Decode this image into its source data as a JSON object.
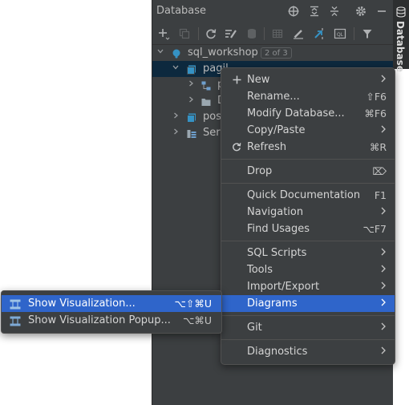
{
  "toolwindow": {
    "title": "Database",
    "header_icons": [
      "crosshair-icon",
      "expand-all-icon",
      "collapse-all-icon",
      "gear-icon",
      "minimize-icon"
    ],
    "toolbar_icons": [
      "add-icon",
      "duplicate-icon",
      "refresh-icon",
      "properties-icon",
      "data-source-icon",
      "table-icon",
      "edit-icon",
      "jump-to-icon",
      "query-console-icon",
      "filter-icon"
    ]
  },
  "side_stripe": {
    "label": "Database",
    "icon": "database-icon"
  },
  "tree": {
    "root": {
      "label": "sql_workshop",
      "badge": "2 of 3"
    },
    "items": [
      {
        "label": "pagil"
      },
      {
        "label": "p"
      },
      {
        "label": "D"
      },
      {
        "label": "pos"
      },
      {
        "label": "Serv"
      }
    ]
  },
  "context_menu": {
    "items": [
      {
        "label": "New",
        "icon": "plus-icon",
        "submenu": true
      },
      {
        "label": "Rename...",
        "shortcut": "⇧F6"
      },
      {
        "label": "Modify Database...",
        "shortcut": "⌘F6"
      },
      {
        "label": "Copy/Paste",
        "submenu": true
      },
      {
        "label": "Refresh",
        "icon": "refresh-icon",
        "shortcut": "⌘R"
      },
      {
        "label": "Drop",
        "shortcut": "⌦"
      },
      {
        "label": "Quick Documentation",
        "shortcut": "F1"
      },
      {
        "label": "Navigation",
        "submenu": true
      },
      {
        "label": "Find Usages",
        "shortcut": "⌥F7"
      },
      {
        "label": "SQL Scripts",
        "submenu": true
      },
      {
        "label": "Tools",
        "submenu": true
      },
      {
        "label": "Import/Export",
        "submenu": true
      },
      {
        "label": "Diagrams",
        "submenu": true,
        "active": true
      },
      {
        "label": "Git",
        "submenu": true
      },
      {
        "label": "Diagnostics",
        "submenu": true
      }
    ]
  },
  "submenu": {
    "items": [
      {
        "label": "Show Visualization...",
        "shortcut": "⌥⇧⌘U",
        "icon": "diagram-icon",
        "active": true
      },
      {
        "label": "Show Visualization Popup...",
        "shortcut": "⌥⌘U",
        "icon": "diagram-icon"
      }
    ]
  },
  "colors": {
    "panel_bg": "#3c3f41",
    "selection": "#2f65ca",
    "tree_selection": "#0d293e",
    "text": "#bbbbbb",
    "db_icon": "#3592c4"
  }
}
